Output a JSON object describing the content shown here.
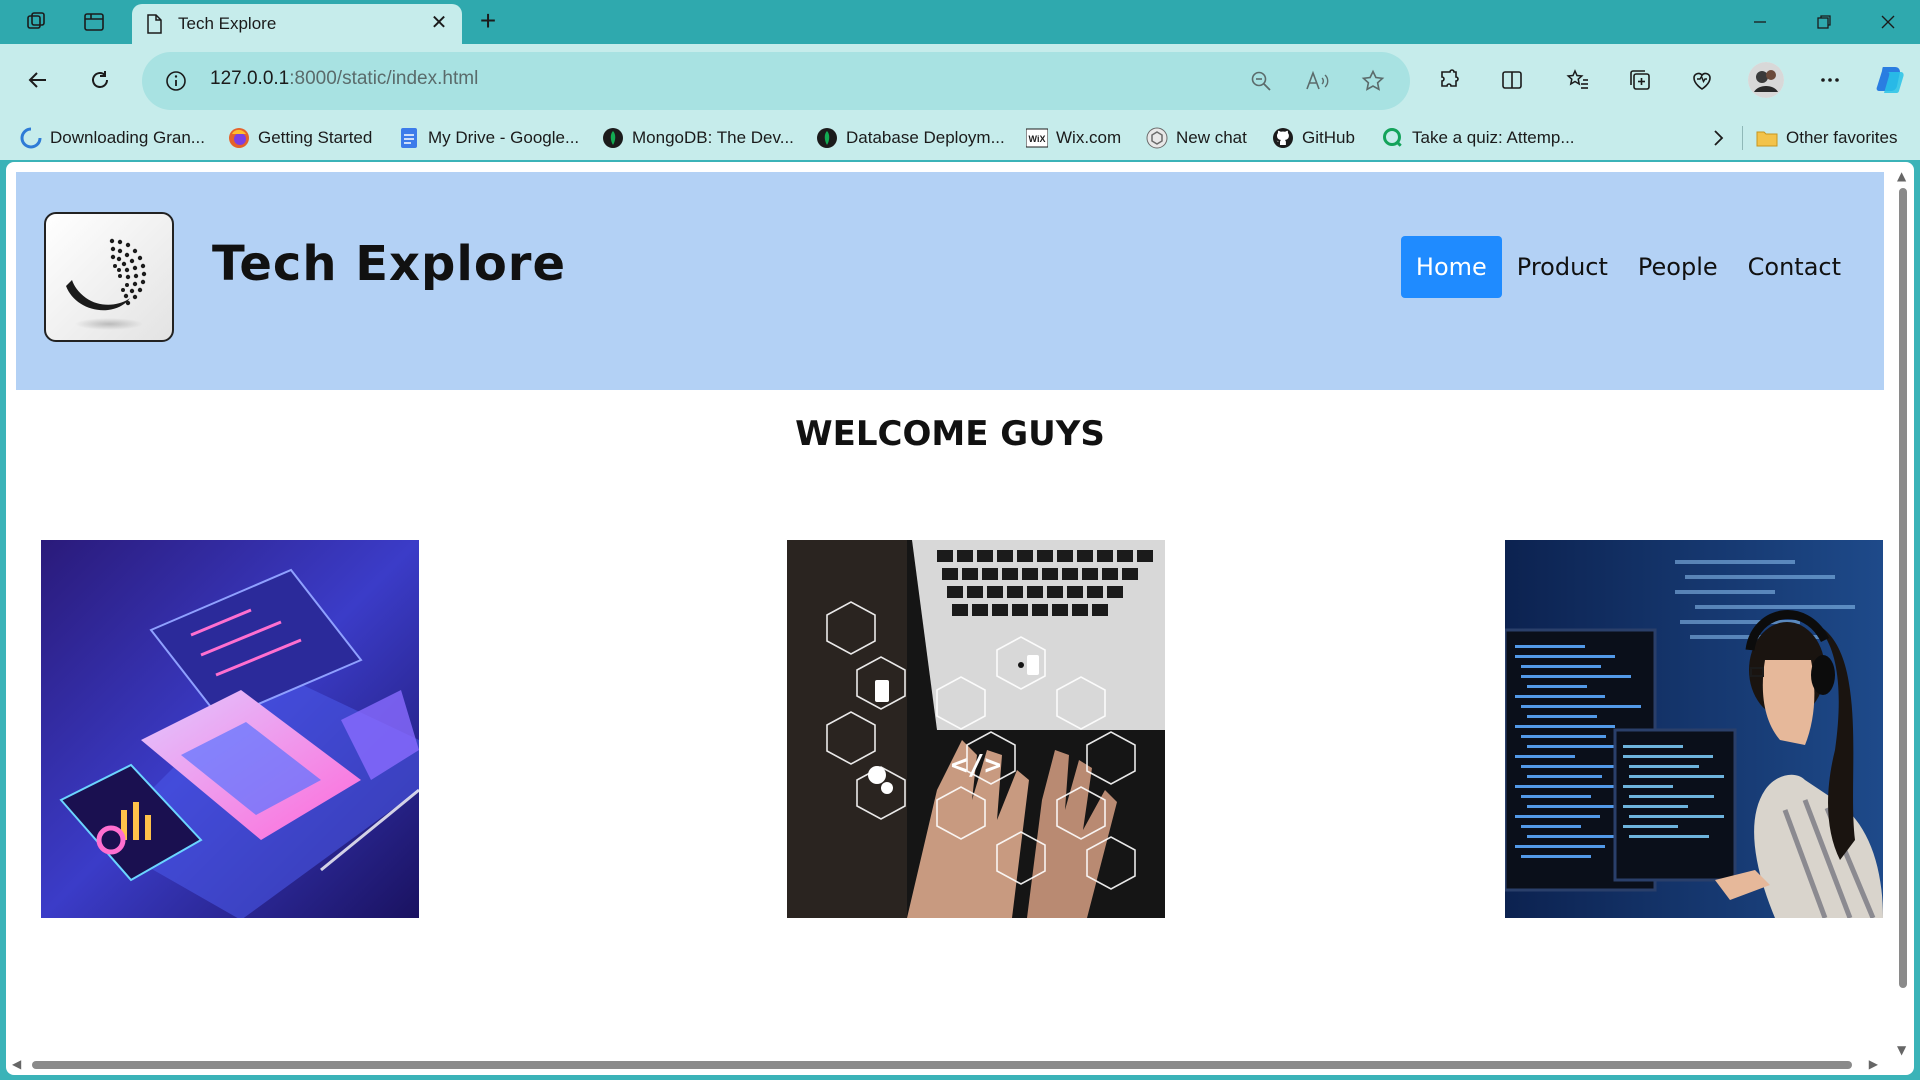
{
  "browser": {
    "tab_title": "Tech Explore",
    "tab_close": "✕",
    "new_tab": "+",
    "url_host": "127.0.0.1",
    "url_rest": ":8000/static/index.html",
    "bookmarks": [
      {
        "label": "Downloading Gran...",
        "icon": "loader-icon",
        "color": "#2e7bd6"
      },
      {
        "label": "Getting Started",
        "icon": "firefox-icon",
        "color": "#e5622a"
      },
      {
        "label": "My Drive - Google...",
        "icon": "docs-icon",
        "color": "#3c7bea"
      },
      {
        "label": "MongoDB: The Dev...",
        "icon": "mongodb-icon",
        "color": "#1b1b1b"
      },
      {
        "label": "Database Deploym...",
        "icon": "mongodb-icon",
        "color": "#1b1b1b"
      },
      {
        "label": "Wix.com",
        "icon": "wix-icon",
        "color": "#ffffff"
      },
      {
        "label": "New chat",
        "icon": "openai-icon",
        "color": "#6b6b6b"
      },
      {
        "label": "GitHub",
        "icon": "github-icon",
        "color": "#1b1b1b"
      },
      {
        "label": "Take a quiz: Attemp...",
        "icon": "quiz-icon",
        "color": "#13a35a"
      }
    ],
    "other_favorites": "Other favorites"
  },
  "site": {
    "title": "Tech Explore",
    "nav": [
      "Home",
      "Product",
      "People",
      "Contact"
    ],
    "active_nav": "Home",
    "welcome": "WELCOME GUYS"
  },
  "colors": {
    "header_bg": "#b3d1f5",
    "nav_active": "#1f8bff",
    "browser_chrome": "#c6eceb"
  }
}
